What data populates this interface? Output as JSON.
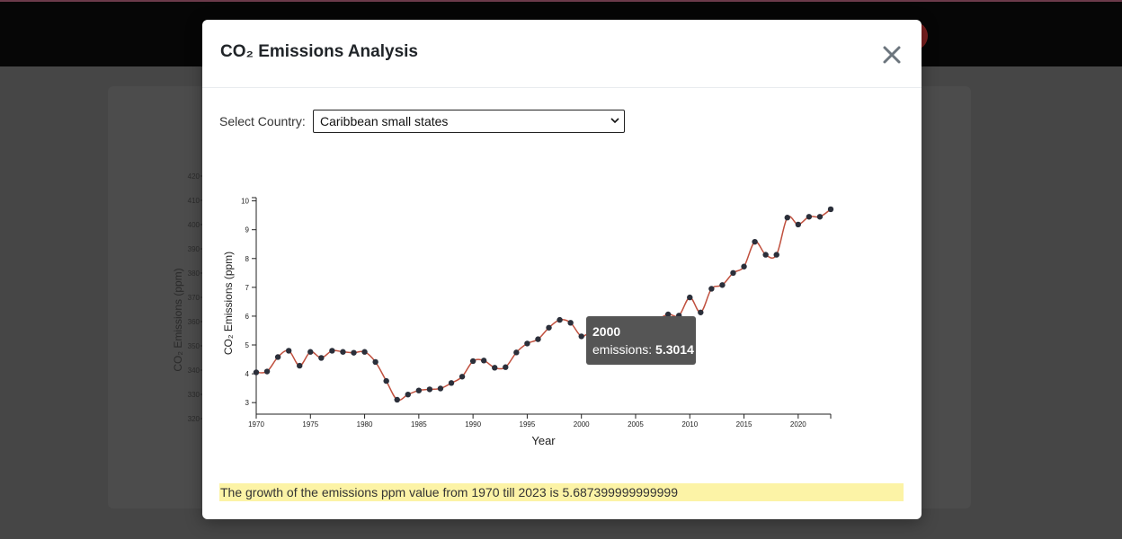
{
  "modal": {
    "title": "CO₂ Emissions Analysis",
    "select_label": "Select Country:",
    "selected_country": "Caribbean small states",
    "growth_text": "The growth of the emissions ppm value from 1970 till 2023 is 5.687399999999999"
  },
  "tooltip": {
    "year": "2000",
    "label": "emissions:",
    "value": "5.3014"
  },
  "background_chart": {
    "ylabel": "CO₂ Emissions (ppm)",
    "ticks": [
      "420",
      "410",
      "400",
      "390",
      "380",
      "370",
      "360",
      "350",
      "340",
      "330",
      "320"
    ]
  },
  "chart_data": {
    "type": "line",
    "xlabel": "Year",
    "ylabel": "CO₂ Emissions (ppm)",
    "xlim": [
      1970,
      2023
    ],
    "ylim": [
      2.6,
      10.3
    ],
    "x_ticks": [
      1970,
      1975,
      1980,
      1985,
      1990,
      1995,
      2000,
      2005,
      2010,
      2015,
      2020
    ],
    "y_ticks": [
      3,
      4,
      5,
      6,
      7,
      8,
      9,
      10
    ],
    "series": [
      {
        "color": "#c0503e",
        "x": [
          1970,
          1971,
          1972,
          1973,
          1974,
          1975,
          1976,
          1977,
          1978,
          1979,
          1980,
          1981,
          1982,
          1983,
          1984,
          1985,
          1986,
          1987,
          1988,
          1989,
          1990,
          1991,
          1992,
          1993,
          1994,
          1995,
          1996,
          1997,
          1998,
          1999,
          2000,
          2001,
          2002,
          2003,
          2004,
          2005,
          2006,
          2007,
          2008,
          2009,
          2010,
          2011,
          2012,
          2013,
          2014,
          2015,
          2016,
          2017,
          2018,
          2019,
          2020,
          2021,
          2022,
          2023
        ],
        "y": [
          4.05,
          4.08,
          4.58,
          4.8,
          4.28,
          4.76,
          4.55,
          4.8,
          4.76,
          4.73,
          4.76,
          4.41,
          3.75,
          3.1,
          3.28,
          3.42,
          3.46,
          3.49,
          3.68,
          3.9,
          4.44,
          4.46,
          4.21,
          4.23,
          4.74,
          5.05,
          5.2,
          5.6,
          5.87,
          5.77,
          5.3,
          5.48,
          5.2,
          5.0,
          5.14,
          5.35,
          5.45,
          5.85,
          6.06,
          6.02,
          6.65,
          6.13,
          6.95,
          7.08,
          7.5,
          7.72,
          8.58,
          8.13,
          8.13,
          9.42,
          9.18,
          9.45,
          9.45,
          9.71
        ]
      }
    ]
  }
}
